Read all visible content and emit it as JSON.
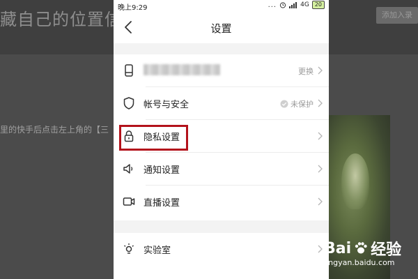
{
  "background": {
    "title_text": "藏自己的位置信",
    "button_text": "添加入录",
    "body_line": "里的快手后点击左上角的【三"
  },
  "status_bar": {
    "time": "晚上9:29",
    "dots": "...",
    "network": "4G",
    "battery": "20"
  },
  "nav": {
    "title": "设置"
  },
  "rows": [
    {
      "label": "",
      "value": "更换",
      "icon": "phone-icon"
    },
    {
      "label": "帐号与安全",
      "value": "未保护",
      "icon": "shield-icon"
    },
    {
      "label": "隐私设置",
      "value": "",
      "icon": "lock-icon"
    },
    {
      "label": "通知设置",
      "value": "",
      "icon": "speaker-icon"
    },
    {
      "label": "直播设置",
      "value": "",
      "icon": "video-camera-icon"
    },
    {
      "label": "实验室",
      "value": "",
      "icon": "bulb-icon"
    }
  ],
  "watermark": {
    "brand_left": "Bai",
    "brand_right": "经验",
    "url": "jingyan.baidu.com"
  },
  "colors": {
    "highlight": "#b3121b",
    "overlay": "#4b4b4b"
  }
}
